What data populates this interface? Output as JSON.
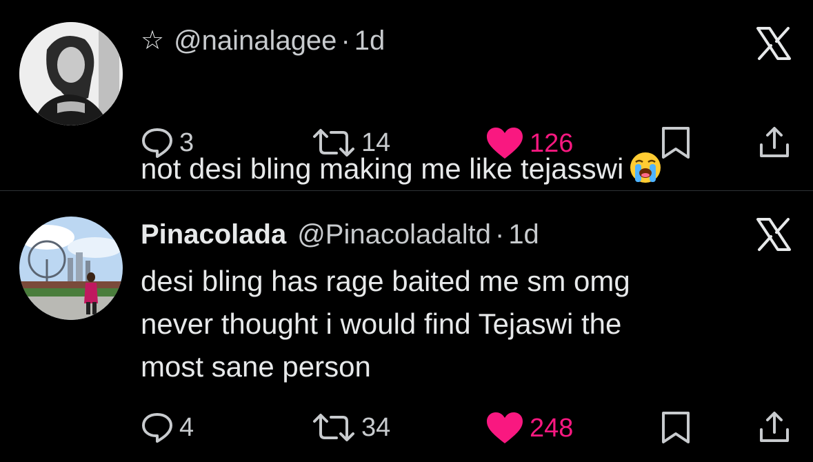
{
  "tweets": [
    {
      "display_name": "",
      "handle": "@nainalagee",
      "separator": "·",
      "time": "1d",
      "text": "not desi bling making me like tejasswi",
      "emoji_icon": "loudly-crying-face-icon",
      "replies": "3",
      "retweets": "14",
      "likes": "126",
      "liked": true,
      "has_star": true
    },
    {
      "display_name": "Pinacolada",
      "handle": "@Pinacoladaltd",
      "separator": "·",
      "time": "1d",
      "text": "desi bling has rage baited me sm omg\nnever thought i would find Tejaswi the\nmost sane person",
      "replies": "4",
      "retweets": "34",
      "likes": "248",
      "liked": true,
      "has_star": false
    }
  ],
  "colors": {
    "background": "#000000",
    "text": "#e7e9ea",
    "muted": "#71767b",
    "like": "#f91880",
    "divider": "#2f3336"
  },
  "icons": [
    "star-icon",
    "x-logo-icon",
    "reply-icon",
    "retweet-icon",
    "heart-icon",
    "bookmark-icon",
    "share-icon"
  ]
}
